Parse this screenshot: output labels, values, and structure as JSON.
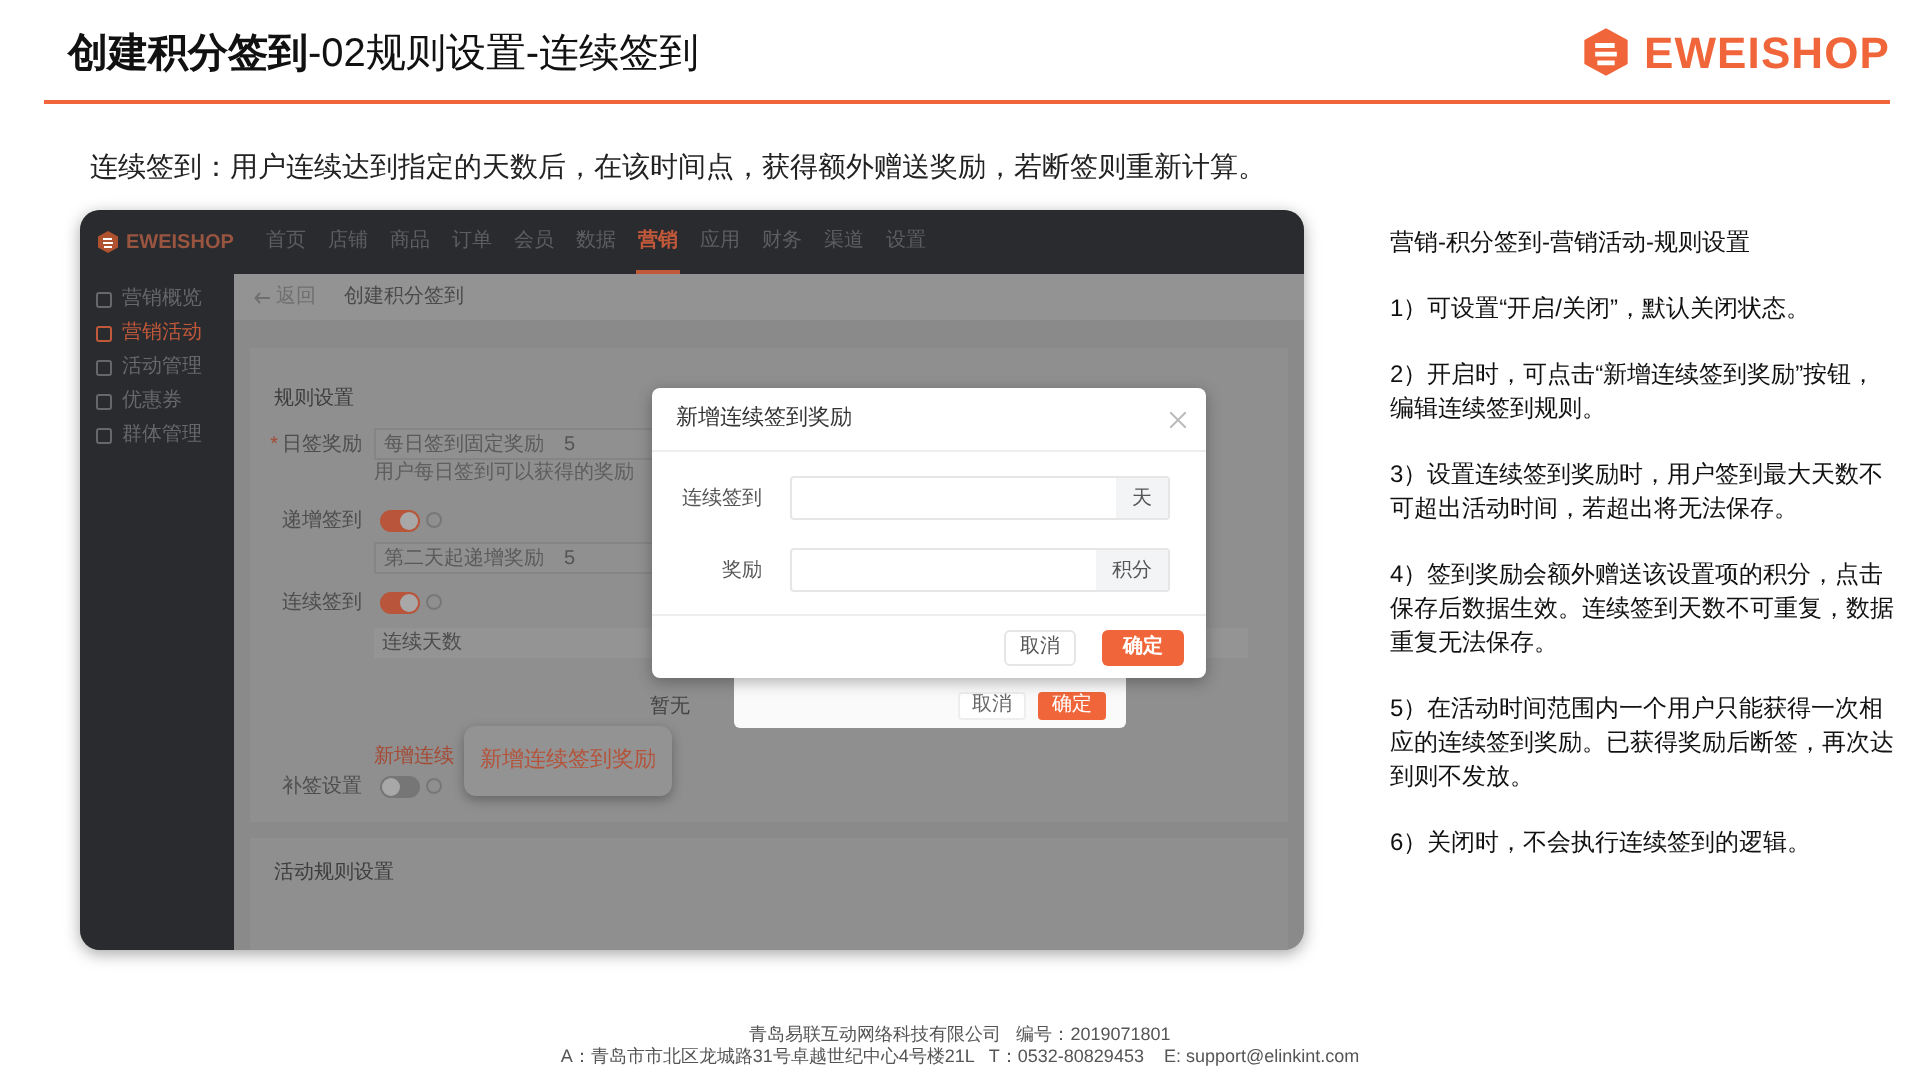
{
  "slide": {
    "title": "**创建积分签到**-02规则设置-连续签到",
    "logo": "EWEISHOP",
    "intro": "连续签到：用户连续达到指定的天数后，在该时间点，获得额外赠送奖励，若断签则重新计算。"
  },
  "app": {
    "logo": "EWEISHOP",
    "nav": [
      {
        "label": "首页",
        "selected": false
      },
      {
        "label": "店铺",
        "selected": false
      },
      {
        "label": "商品",
        "selected": false
      },
      {
        "label": "订单",
        "selected": false
      },
      {
        "label": "会员",
        "selected": false
      },
      {
        "label": "数据",
        "selected": false
      },
      {
        "label": "营销",
        "selected": true
      },
      {
        "label": "应用",
        "selected": false
      },
      {
        "label": "财务",
        "selected": false
      },
      {
        "label": "渠道",
        "selected": false
      },
      {
        "label": "设置",
        "selected": false
      }
    ],
    "sidebar": [
      {
        "label": "营销概览",
        "selected": false
      },
      {
        "label": "营销活动",
        "selected": true
      },
      {
        "label": "活动管理",
        "selected": false
      },
      {
        "label": "优惠券",
        "selected": false
      },
      {
        "label": "群体管理",
        "selected": false
      }
    ],
    "breadcrumb": {
      "back": "返回",
      "title": "创建积分签到"
    },
    "section_title": "规则设置",
    "form": [
      {
        "kind": "input",
        "label": "日签奖励",
        "required_mark": "*",
        "field_label": "每日签到固定奖励",
        "value": "5",
        "hint": "用户每日签到可以获得的奖励"
      },
      {
        "kind": "toggle",
        "label": "递增签到",
        "on": true,
        "field_label": "第二天起递增奖励",
        "value": "5"
      },
      {
        "kind": "table",
        "label": "连续签到",
        "on": true,
        "column": "连续天数",
        "empty": "暂无",
        "link": "新增连续"
      },
      {
        "kind": "toggle",
        "label": "补签设置",
        "on": false
      }
    ],
    "section2_title": "活动规则设置",
    "back_dialog": {
      "cancel": "取消",
      "ok": "确定"
    },
    "dialog": {
      "title": "新增连续签到奖励",
      "fields": [
        {
          "label": "连续签到",
          "suffix": "天"
        },
        {
          "label": "奖励",
          "suffix": "积分"
        }
      ],
      "cancel": "取消",
      "ok": "确定"
    },
    "callout": "新增连续签到奖励"
  },
  "notes": [
    "营销-积分签到-营销活动-规则设置",
    "1）可设置“开启/关闭”，默认关闭状态。",
    "2）开启时，可点击“新增连续签到奖励”按钮，编辑连续签到规则。",
    "3）设置连续签到奖励时，用户签到最大天数不可超出活动时间，若超出将无法保存。",
    "4）签到奖励会额外赠送该设置项的积分，点击保存后数据生效。连续签到天数不可重复，数据重复无法保存。",
    "5）在活动时间范围内一个用户只能获得一次相应的连续签到奖励。已获得奖励后断签，再次达到则不发放。",
    "6）关闭时，不会执行连续签到的逻辑。"
  ],
  "footer": [
    "青岛易联互动网络科技有限公司   编号：2019071801",
    "A：青岛市市北区龙城路31号卓越世纪中心4号楼21L   T：0532-80829453    E: support@elinkint.com"
  ]
}
